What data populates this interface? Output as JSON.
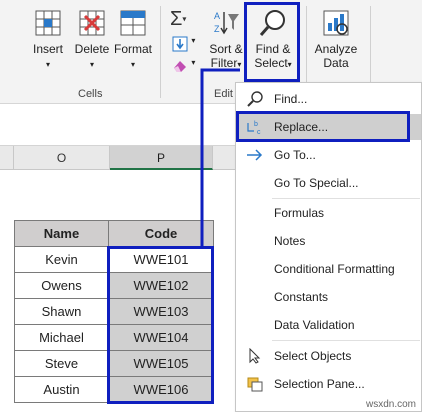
{
  "ribbon": {
    "insert_label": "Insert",
    "delete_label": "Delete",
    "format_label": "Format",
    "cells_group": "Cells",
    "sigma_glyph": "Σ",
    "sort_label1": "Sort &",
    "sort_label2": "Filter",
    "edit_group": "Edit",
    "find_label1": "Find &",
    "find_label2": "Select",
    "analyze_label1": "Analyze",
    "analyze_label2": "Data"
  },
  "columns": [
    "O",
    "P"
  ],
  "table": {
    "headers": [
      "Name",
      "Code"
    ],
    "rows": [
      {
        "name": "Kevin",
        "code": "WWE101"
      },
      {
        "name": "Owens",
        "code": "WWE102"
      },
      {
        "name": "Shawn",
        "code": "WWE103"
      },
      {
        "name": "Michael",
        "code": "WWE104"
      },
      {
        "name": "Steve",
        "code": "WWE105"
      },
      {
        "name": "Austin",
        "code": "WWE106"
      }
    ]
  },
  "menu": {
    "find": "Find...",
    "replace": "Replace...",
    "goto": "Go To...",
    "goto_special": "Go To Special...",
    "formulas": "Formulas",
    "notes": "Notes",
    "conditional": "Conditional Formatting",
    "constants": "Constants",
    "validation": "Data Validation",
    "select_objects": "Select Objects",
    "selection_pane": "Selection Pane..."
  },
  "watermark": "wsxdn.com",
  "colors": {
    "highlight": "#0f1fbf",
    "menu_hot": "#cfcfcf",
    "header_fill": "#d0cece",
    "selected_fill": "#d0d0d0"
  }
}
